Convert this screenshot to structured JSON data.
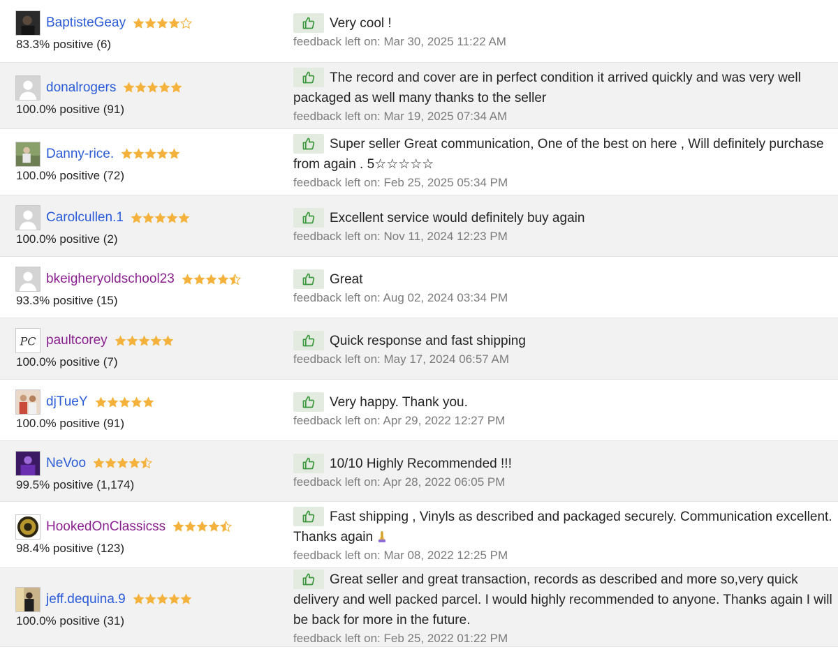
{
  "colors": {
    "link_blue": "#2a5bd7",
    "link_visited": "#8a1f8f",
    "star": "#f4b23c",
    "thumb_green": "#39963a",
    "thumb_bg": "#e3ebe1",
    "meta_gray": "#7b7b7b"
  },
  "feedback": [
    {
      "username": "BaptisteGeay",
      "visited": false,
      "rating": 4,
      "avatar": "photo-dark",
      "positive": "83.3% positive (6)",
      "comment": "Very cool !",
      "meta": "feedback left on: Mar 30, 2025 11:22 AM"
    },
    {
      "username": "donalrogers",
      "visited": false,
      "rating": 5,
      "avatar": "placeholder",
      "positive": "100.0% positive (91)",
      "comment": "The record and cover are in perfect condition it arrived quickly and was very well packaged as well many thanks to the seller",
      "meta": "feedback left on: Mar 19, 2025 07:34 AM"
    },
    {
      "username": "Danny-rice.",
      "visited": false,
      "rating": 5,
      "avatar": "photo-outdoor",
      "positive": "100.0% positive (72)",
      "comment": "Super seller Great communication, One of the best on here , Will definitely purchase from again . 5☆☆☆☆☆",
      "meta": "feedback left on: Feb 25, 2025 05:34 PM"
    },
    {
      "username": "Carolcullen.1",
      "visited": false,
      "rating": 5,
      "avatar": "placeholder",
      "positive": "100.0% positive (2)",
      "comment": "Excellent service would definitely buy again",
      "meta": "feedback left on: Nov 11, 2024 12:23 PM"
    },
    {
      "username": "bkeigheryoldschool23",
      "visited": true,
      "rating": 4.5,
      "avatar": "placeholder",
      "positive": "93.3% positive (15)",
      "comment": "Great",
      "meta": "feedback left on: Aug 02, 2024 03:34 PM"
    },
    {
      "username": "paultcorey",
      "visited": true,
      "rating": 5,
      "avatar": "initials",
      "avatar_text": "PC",
      "positive": "100.0% positive (7)",
      "comment": "Quick response and fast shipping",
      "meta": "feedback left on: May 17, 2024 06:57 AM"
    },
    {
      "username": "djTueY",
      "visited": false,
      "rating": 5,
      "avatar": "photo-people",
      "positive": "100.0% positive (91)",
      "comment": "Very happy. Thank you.",
      "meta": "feedback left on: Apr 29, 2022 12:27 PM"
    },
    {
      "username": "NeVoo",
      "visited": false,
      "rating": 4.5,
      "avatar": "photo-purple",
      "positive": "99.5% positive (1,174)",
      "comment": "10/10 Highly Recommended !!!",
      "meta": "feedback left on: Apr 28, 2022 06:05 PM"
    },
    {
      "username": "HookedOnClassicss",
      "visited": true,
      "rating": 4.5,
      "avatar": "photo-logo",
      "positive": "98.4% positive (123)",
      "comment": "Fast shipping , Vinyls as described and packaged securely. Communication excellent. Thanks again",
      "emoji": "pray-icon",
      "meta": "feedback left on: Mar 08, 2022 12:25 PM"
    },
    {
      "username": "jeff.dequina.9",
      "visited": false,
      "rating": 5,
      "avatar": "photo-room",
      "positive": "100.0% positive (31)",
      "comment": "Great seller and great transaction, records as described and more so,very quick delivery and well packed parcel. I would highly recommended to anyone. Thanks again I will be back for more in the future.",
      "meta": "feedback left on: Feb 25, 2022 01:22 PM"
    }
  ]
}
